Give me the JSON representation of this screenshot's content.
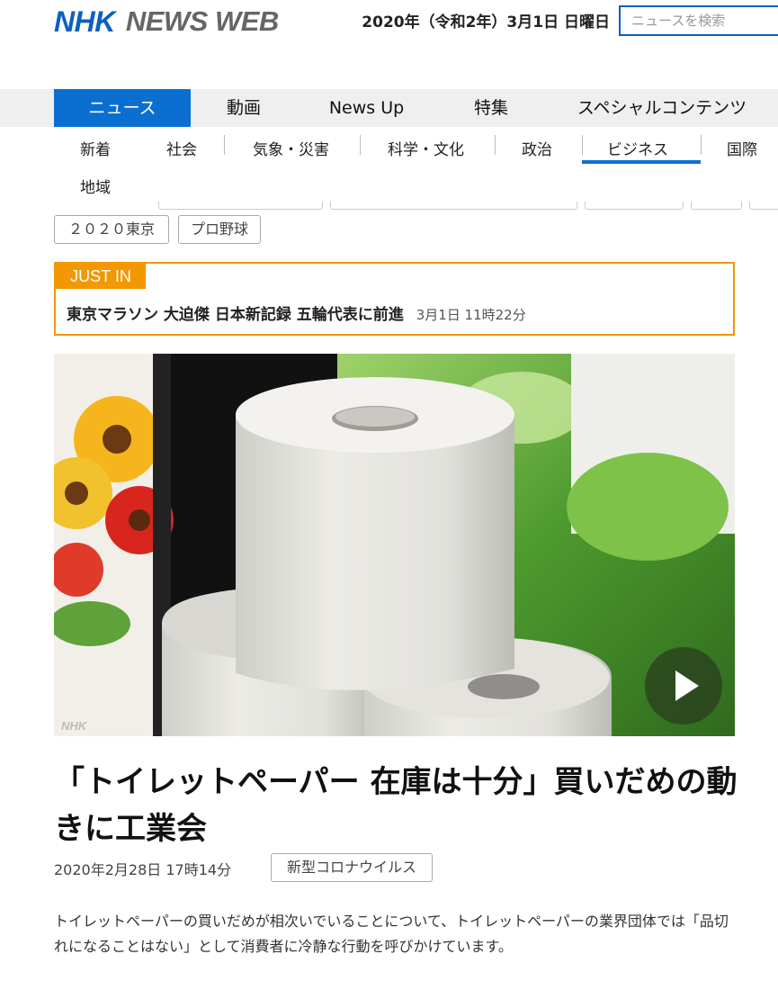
{
  "header": {
    "logo_primary": "NHK",
    "logo_secondary": "NEWS WEB",
    "date": "2020年（令和2年）3月1日 日曜日",
    "search_placeholder": "ニュースを検索"
  },
  "main_nav": [
    {
      "label": "ニュース",
      "active": true
    },
    {
      "label": "動画"
    },
    {
      "label": "News Up"
    },
    {
      "label": "特集"
    },
    {
      "label": "スペシャルコンテンツ"
    }
  ],
  "sub_nav": [
    {
      "label": "新着"
    },
    {
      "label": "社会"
    },
    {
      "label": "気象・災害"
    },
    {
      "label": "科学・文化"
    },
    {
      "label": "政治"
    },
    {
      "label": "ビジネス",
      "active": true
    },
    {
      "label": "国際"
    },
    {
      "label": "地域"
    }
  ],
  "topic_tags": [
    "２０２０東京",
    "プロ野球"
  ],
  "just_in": {
    "label": "JUST IN",
    "headline": "東京マラソン 大迫傑 日本新記録 五輪代表に前進",
    "time": "3月1日 11時22分"
  },
  "article": {
    "image_watermark": "NHK",
    "title": "「トイレットペーパー 在庫は十分」買いだめの動きに工業会",
    "date": "2020年2月28日 17時14分",
    "category": "新型コロナウイルス",
    "lead": "トイレットペーパーの買いだめが相次いでいることについて、トイレットペーパーの業界団体では「品切れになることはない」として消費者に冷静な行動を呼びかけています。"
  },
  "colors": {
    "brand_blue": "#0b6fd1",
    "just_in_orange": "#f39800"
  }
}
